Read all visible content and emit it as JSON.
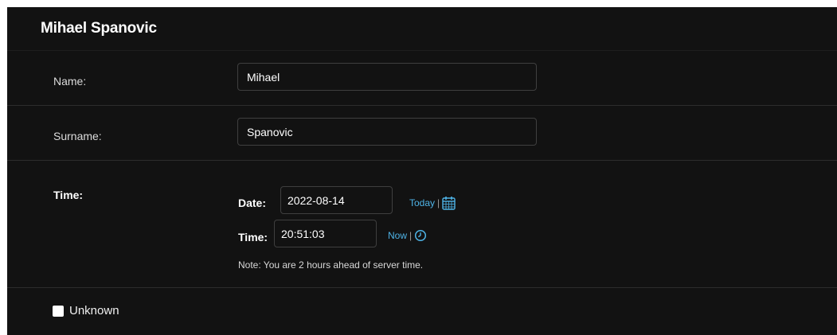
{
  "heading": "Mihael Spanovic",
  "fields": {
    "name": {
      "label": "Name:",
      "value": "Mihael"
    },
    "surname": {
      "label": "Surname:",
      "value": "Spanovic"
    },
    "time": {
      "label": "Time:",
      "date_label": "Date:",
      "date_value": "2022-08-14",
      "today_link": "Today",
      "time_label": "Time:",
      "time_value": "20:51:03",
      "now_link": "Now",
      "separator": "|",
      "note": "Note: You are 2 hours ahead of server time."
    },
    "unknown": {
      "label": "Unknown",
      "checked": false
    }
  },
  "colors": {
    "background": "#121212",
    "link": "#4eb3e6",
    "border": "#3f3f3f"
  },
  "icons": {
    "calendar": "calendar-icon",
    "clock": "clock-icon"
  }
}
